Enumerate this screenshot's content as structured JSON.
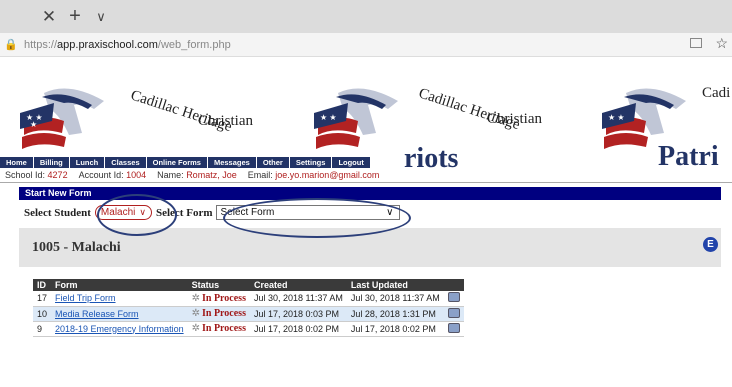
{
  "browser": {
    "url_prefix": "https://",
    "url_host": "app.praxischool.com",
    "url_path": "/web_form.php"
  },
  "banner": {
    "school_line1": "Cadillac Heritage",
    "school_line2": "Christian",
    "mascot_partial_1": "riots",
    "mascot_partial_2": "Patri",
    "partial_name": "Cadi"
  },
  "nav": {
    "items": [
      "Home",
      "Billing",
      "Lunch",
      "Classes",
      "Online Forms",
      "Messages",
      "Other",
      "Settings",
      "Logout"
    ]
  },
  "info": {
    "school_id_label": "School Id:",
    "school_id": "4272",
    "account_id_label": "Account Id:",
    "account_id": "1004",
    "name_label": "Name:",
    "name": "Romatz, Joe",
    "email_label": "Email:",
    "email": "joe.yo.marion@gmail.com"
  },
  "panel": {
    "title": "Start New Form",
    "select_student_label": "Select Student",
    "student_value": "Malachi",
    "select_form_label": "Select Form",
    "form_value": "Select Form"
  },
  "student": {
    "heading": "1005 - Malachi",
    "icon_letter": "E"
  },
  "table": {
    "headers": [
      "ID",
      "Form",
      "Status",
      "Created",
      "Last Updated",
      ""
    ],
    "rows": [
      {
        "id": "17",
        "form": "Field Trip Form",
        "status": "In Process",
        "created": "Jul 30, 2018 11:37 AM",
        "updated": "Jul 30, 2018 11:37 AM"
      },
      {
        "id": "10",
        "form": "Media Release Form",
        "status": "In Process",
        "created": "Jul 17, 2018 0:03 PM",
        "updated": "Jul 28, 2018 1:31 PM"
      },
      {
        "id": "9",
        "form": "2018-19 Emergency Information",
        "status": "In Process",
        "created": "Jul 17, 2018 0:02 PM",
        "updated": "Jul 17, 2018 0:02 PM"
      }
    ]
  },
  "colors": {
    "nav_bg": "#223366",
    "panel_head_bg": "#000080",
    "accent_red": "#b02020",
    "link_blue": "#1a55b5"
  }
}
